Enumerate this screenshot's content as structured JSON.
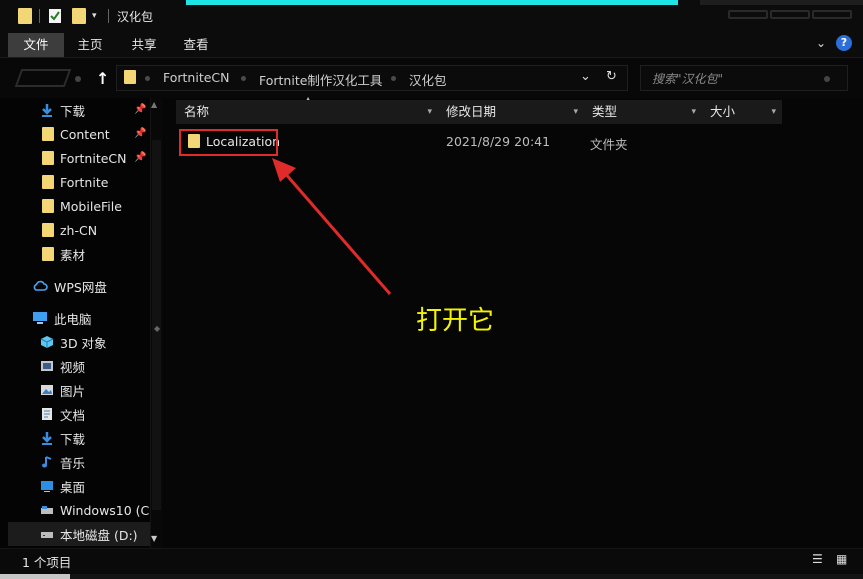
{
  "window": {
    "title": "汉化包",
    "minimize_glyph": "—",
    "maximize_glyph": "☐",
    "close_glyph": "✕"
  },
  "ribbon": {
    "tabs": [
      {
        "label": "文件",
        "active": true
      },
      {
        "label": "主页",
        "active": false
      },
      {
        "label": "共享",
        "active": false
      },
      {
        "label": "查看",
        "active": false
      }
    ],
    "expand_glyph": "⌄",
    "help_glyph": "?"
  },
  "address": {
    "up_glyph": "🡑",
    "crumbs": [
      "FortniteCN",
      "Fortnite制作汉化工具",
      "汉化包"
    ],
    "dropdown_glyph": "⌄",
    "refresh_glyph": "↻"
  },
  "search": {
    "placeholder": "搜索\"汉化包\""
  },
  "sidebar": {
    "quick_access": [
      {
        "label": "下载",
        "icon": "download-arrow-icon",
        "pinned": true
      },
      {
        "label": "Content",
        "icon": "folder-icon",
        "pinned": true
      },
      {
        "label": "FortniteCN",
        "icon": "folder-icon",
        "pinned": true
      },
      {
        "label": "Fortnite",
        "icon": "folder-icon",
        "pinned": false
      },
      {
        "label": "MobileFile",
        "icon": "folder-icon",
        "pinned": false
      },
      {
        "label": "zh-CN",
        "icon": "folder-icon",
        "pinned": false
      },
      {
        "label": "素材",
        "icon": "folder-icon",
        "pinned": false
      }
    ],
    "cloud": {
      "label": "WPS网盘",
      "icon": "cloud-icon"
    },
    "this_pc": {
      "label": "此电脑",
      "icon": "computer-icon"
    },
    "pc_items": [
      {
        "label": "3D 对象",
        "icon": "cube-3d-icon"
      },
      {
        "label": "视频",
        "icon": "video-icon"
      },
      {
        "label": "图片",
        "icon": "picture-icon"
      },
      {
        "label": "文档",
        "icon": "document-icon"
      },
      {
        "label": "下载",
        "icon": "download-arrow-icon"
      },
      {
        "label": "音乐",
        "icon": "music-note-icon"
      },
      {
        "label": "桌面",
        "icon": "desktop-icon"
      },
      {
        "label": "Windows10 (C:",
        "icon": "drive-c-icon"
      },
      {
        "label": "本地磁盘 (D:)",
        "icon": "drive-icon"
      }
    ],
    "pin_glyph": "📌"
  },
  "columns": {
    "name": "名称",
    "date": "修改日期",
    "type": "类型",
    "size": "大小"
  },
  "files": [
    {
      "name": "Localization",
      "date": "2021/8/29 20:41",
      "type": "文件夹",
      "size": ""
    }
  ],
  "annotation": {
    "text": "打开它",
    "color": "#f4f400",
    "box_color": "#e02b2b",
    "arrow_color": "#e02b2b"
  },
  "status": {
    "item_count": "1 个项目"
  },
  "colors": {
    "accent": "#1ee6e6",
    "folder": "#f3d675",
    "background": "#050505",
    "selected_tab": "#3d3d3d"
  }
}
